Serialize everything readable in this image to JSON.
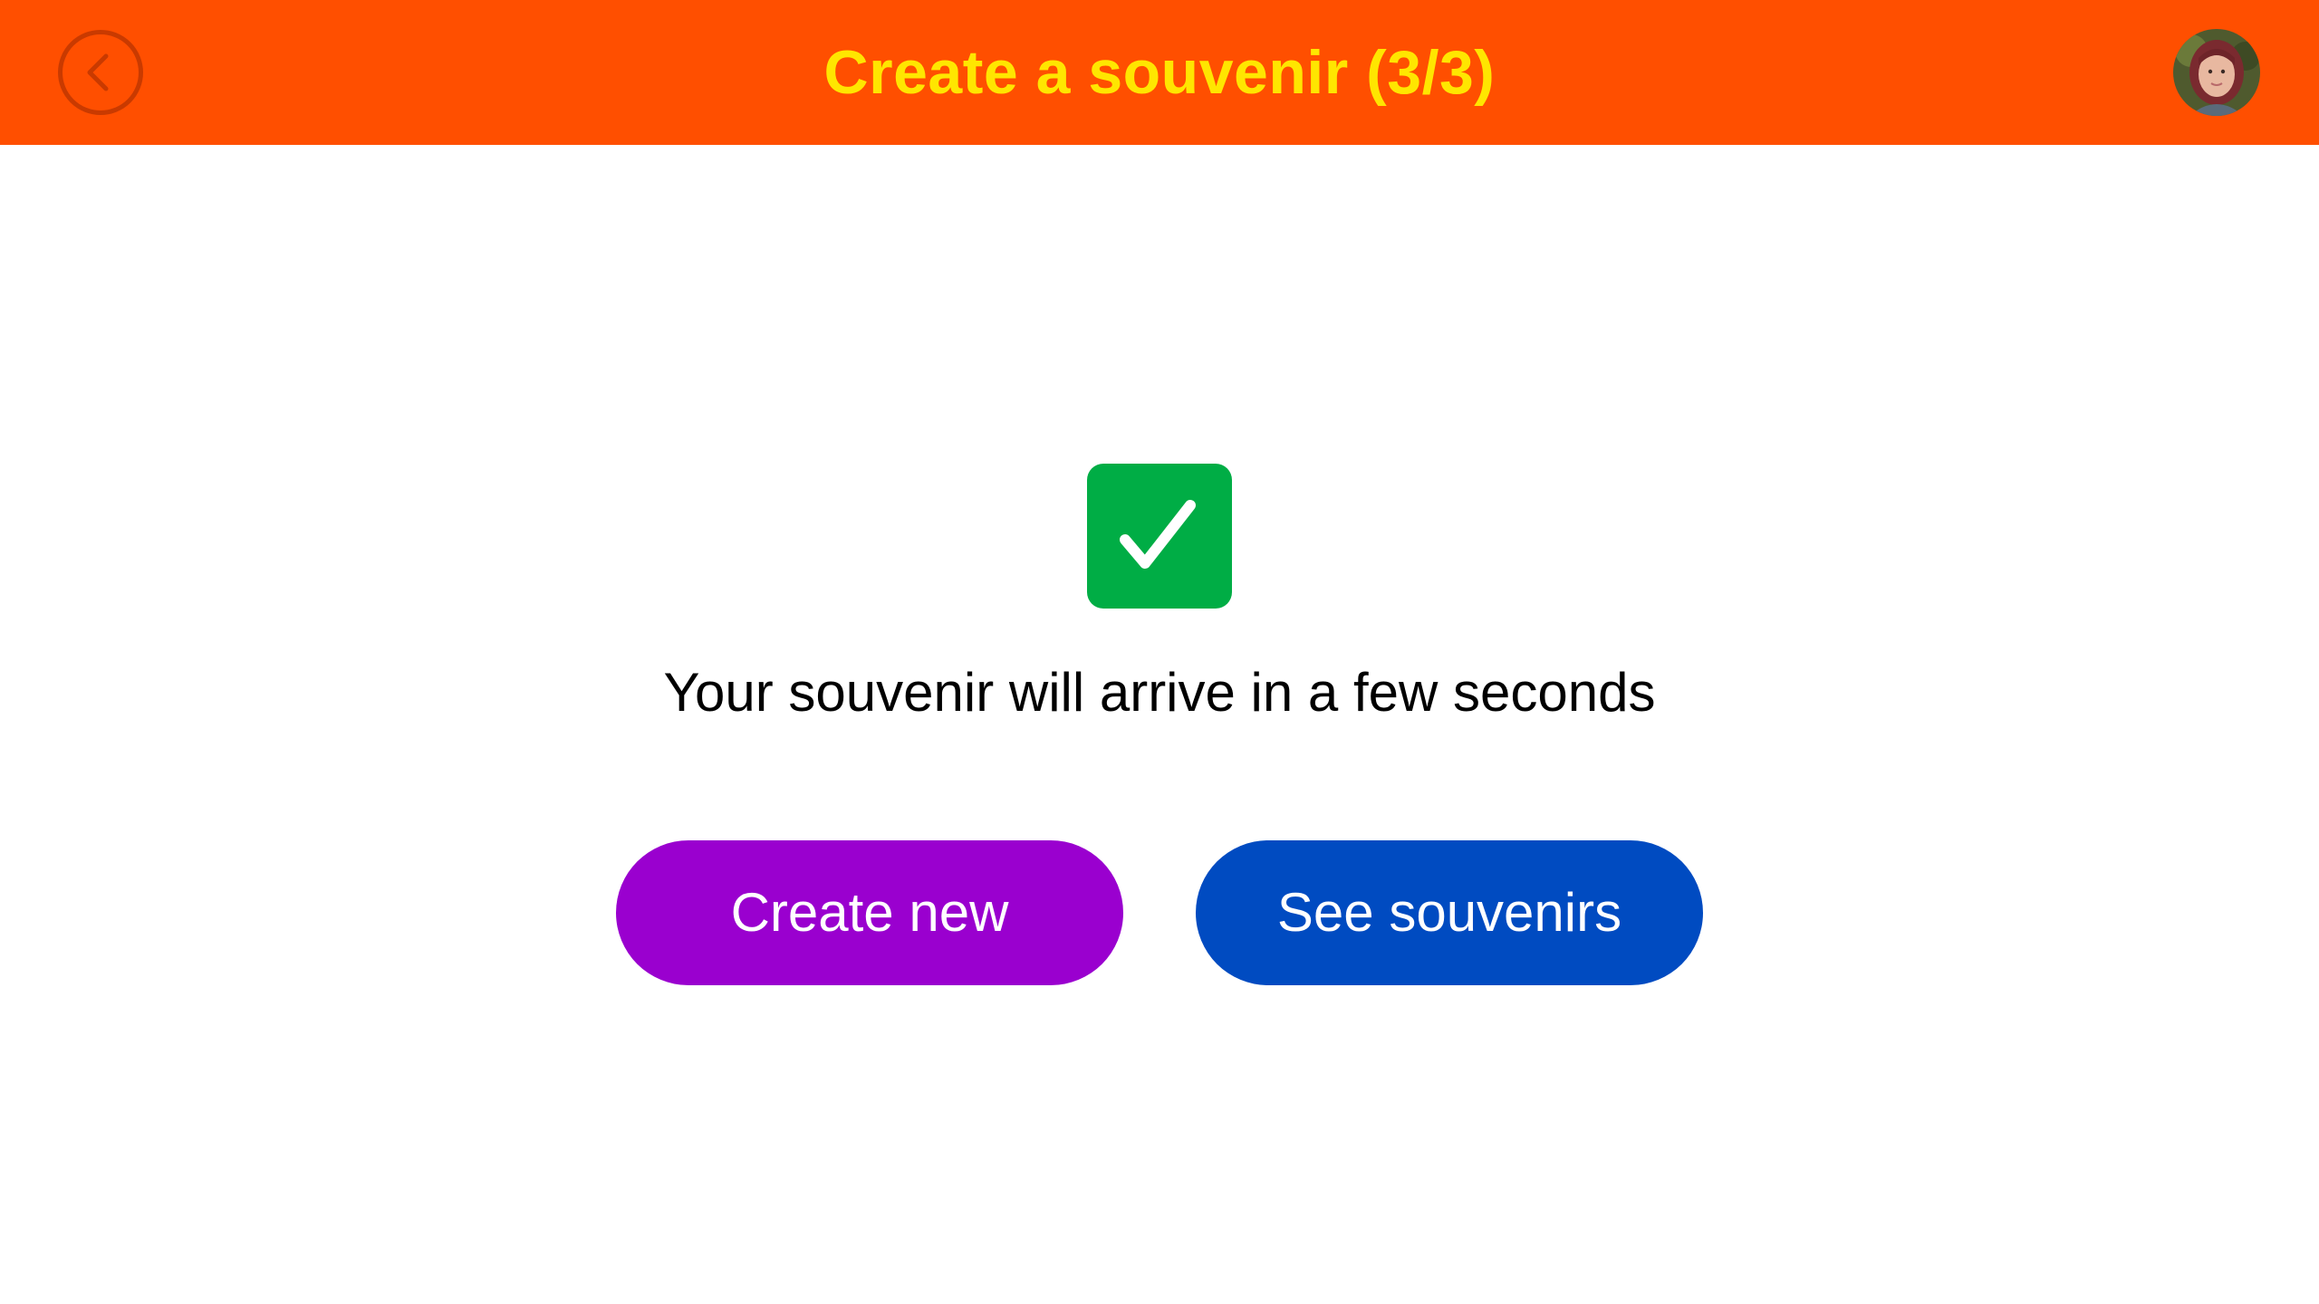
{
  "header": {
    "title": "Create a souvenir (3/3)",
    "back_icon": "chevron-left-icon",
    "avatar_icon": "user-avatar",
    "background_color": "#ff4f00",
    "title_color": "#ffe600"
  },
  "main": {
    "status_icon": "checkmark-icon",
    "status_color": "#00ad45",
    "message": "Your souvenir will arrive in a few seconds",
    "buttons": [
      {
        "label": "Create new",
        "color": "#9a00cf"
      },
      {
        "label": "See souvenirs",
        "color": "#004bc1"
      }
    ]
  }
}
